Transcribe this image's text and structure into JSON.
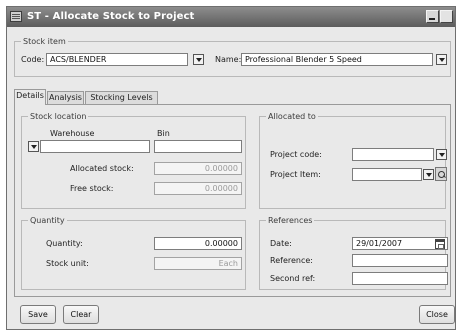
{
  "window": {
    "title": "ST - Allocate Stock to Project"
  },
  "stock_item": {
    "legend": "Stock item",
    "code_label": "Code:",
    "code_value": "ACS/BLENDER",
    "name_label": "Name:",
    "name_value": "Professional Blender 5 Speed"
  },
  "tabs": [
    {
      "label": "Details"
    },
    {
      "label": "Analysis"
    },
    {
      "label": "Stocking Levels"
    }
  ],
  "stock_location": {
    "legend": "Stock location",
    "warehouse_header": "Warehouse",
    "bin_header": "Bin",
    "warehouse_value": "",
    "bin_value": "",
    "allocated_stock_label": "Allocated stock:",
    "allocated_stock_value": "0.00000",
    "free_stock_label": "Free stock:",
    "free_stock_value": "0.00000"
  },
  "allocated_to": {
    "legend": "Allocated to",
    "project_code_label": "Project code:",
    "project_code_value": "",
    "project_item_label": "Project Item:",
    "project_item_value": ""
  },
  "quantity": {
    "legend": "Quantity",
    "quantity_label": "Quantity:",
    "quantity_value": "0.00000",
    "stock_unit_label": "Stock unit:",
    "stock_unit_value": "Each"
  },
  "references": {
    "legend": "References",
    "date_label": "Date:",
    "date_value": "29/01/2007",
    "reference_label": "Reference:",
    "reference_value": "",
    "second_ref_label": "Second ref:",
    "second_ref_value": ""
  },
  "footer": {
    "save_label": "Save",
    "clear_label": "Clear",
    "close_label": "Close"
  }
}
